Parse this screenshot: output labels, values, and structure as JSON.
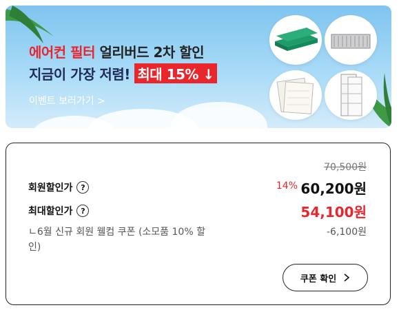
{
  "banner": {
    "line1_red": "에어컨 필터 ",
    "line1_dark": "얼리버드 2차 할인",
    "line2_text": "지금이 가장 저렴! ",
    "line2_highlight": "최대 15% ↓",
    "link": "이벤트 보러가기 >"
  },
  "price": {
    "original": "70,500원",
    "member_label": "회원할인가",
    "member_discount": "14%",
    "member_price": "60,200원",
    "max_label": "최대할인가",
    "max_price": "54,100원",
    "coupon_desc": "ㄴ6월 신규 회원 웰컴 쿠폰 (소모품 10% 할인)",
    "coupon_amount": "-6,100원",
    "coupon_button": "쿠폰 확인"
  },
  "colors": {
    "accent_red": "#e8262c"
  }
}
